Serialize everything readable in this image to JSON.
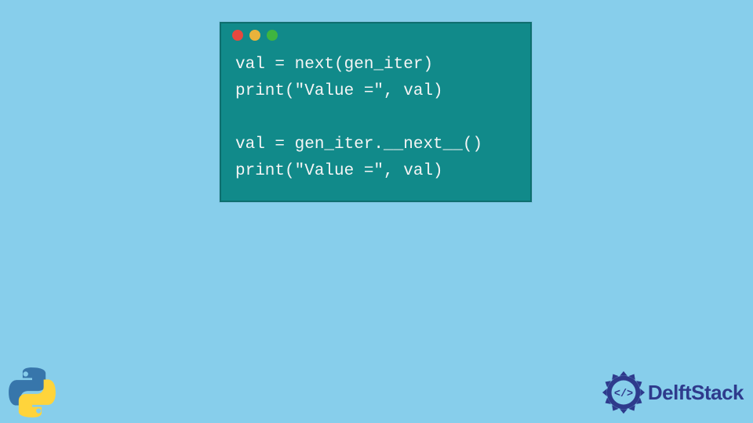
{
  "code": {
    "line1": "val = next(gen_iter)",
    "line2": "print(\"Value =\", val)",
    "line3": "",
    "line4": "val = gen_iter.__next__()",
    "line5": "print(\"Value =\", val)"
  },
  "branding": {
    "site_name": "DelftStack"
  },
  "icons": {
    "python": "python-logo",
    "delft": "delftstack-logo"
  },
  "colors": {
    "background": "#87ceeb",
    "window_bg": "#118a8a",
    "code_text": "#f5f5f5",
    "brand_text": "#2e3a8c"
  }
}
